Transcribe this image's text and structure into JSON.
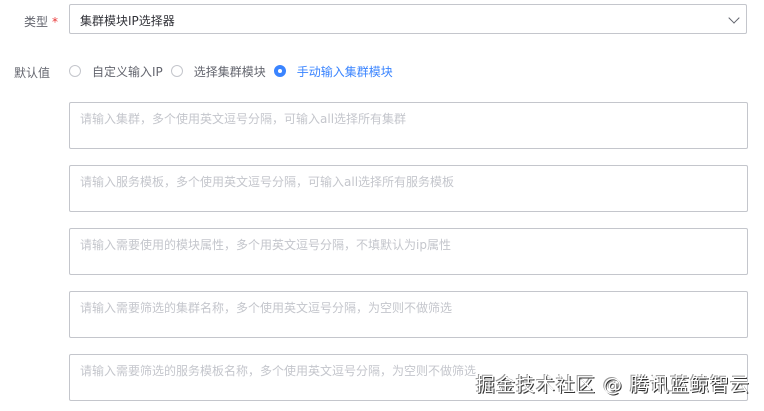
{
  "type_field": {
    "label": "类型",
    "required": "*",
    "value": "集群模块IP选择器"
  },
  "default_field": {
    "label": "默认值",
    "options": [
      {
        "label": "自定义输入IP",
        "checked": false
      },
      {
        "label": "选择集群模块",
        "checked": false
      },
      {
        "label": "手动输入集群模块",
        "checked": true
      }
    ]
  },
  "inputs": [
    {
      "placeholder": "请输入集群，多个使用英文逗号分隔，可输入all选择所有集群"
    },
    {
      "placeholder": "请输入服务模板，多个使用英文逗号分隔，可输入all选择所有服务模板"
    },
    {
      "placeholder": "请输入需要使用的模块属性，多个用英文逗号分隔，不填默认为ip属性"
    },
    {
      "placeholder": "请输入需要筛选的集群名称，多个使用英文逗号分隔，为空则不做筛选"
    },
    {
      "placeholder": "请输入需要筛选的服务模板名称，多个使用英文逗号分隔，为空则不做筛选"
    }
  ],
  "watermark": "掘金技术社区 @ 腾讯蓝鲸智云",
  "colors": {
    "accent": "#3a84ff",
    "required": "#ea3636"
  }
}
